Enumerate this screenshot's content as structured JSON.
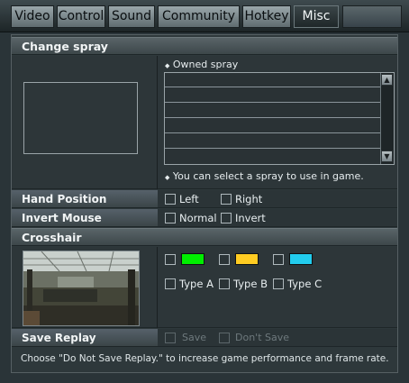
{
  "tabs": [
    {
      "label": "Video",
      "active": false
    },
    {
      "label": "Control",
      "active": false
    },
    {
      "label": "Sound",
      "active": false
    },
    {
      "label": "Community",
      "active": false
    },
    {
      "label": "Hotkey",
      "active": false
    },
    {
      "label": "Misc",
      "active": true
    }
  ],
  "change_spray": {
    "title": "Change spray",
    "list_header": "Owned spray",
    "hint": "You can select a spray to use in game.",
    "list_rows": 5
  },
  "hand_position": {
    "label": "Hand Position",
    "options": [
      "Left",
      "Right"
    ]
  },
  "invert_mouse": {
    "label": "Invert Mouse",
    "options": [
      "Normal",
      "Invert"
    ]
  },
  "crosshair": {
    "title": "Crosshair",
    "colors": [
      "#00ee00",
      "#ffcc22",
      "#22ccee"
    ],
    "types": [
      "Type A",
      "Type B",
      "Type C"
    ]
  },
  "save_replay": {
    "label": "Save Replay",
    "options": [
      "Save",
      "Don't Save"
    ],
    "enabled": false
  },
  "footer": "Choose \"Do Not Save Replay.\" to increase game performance and frame rate."
}
